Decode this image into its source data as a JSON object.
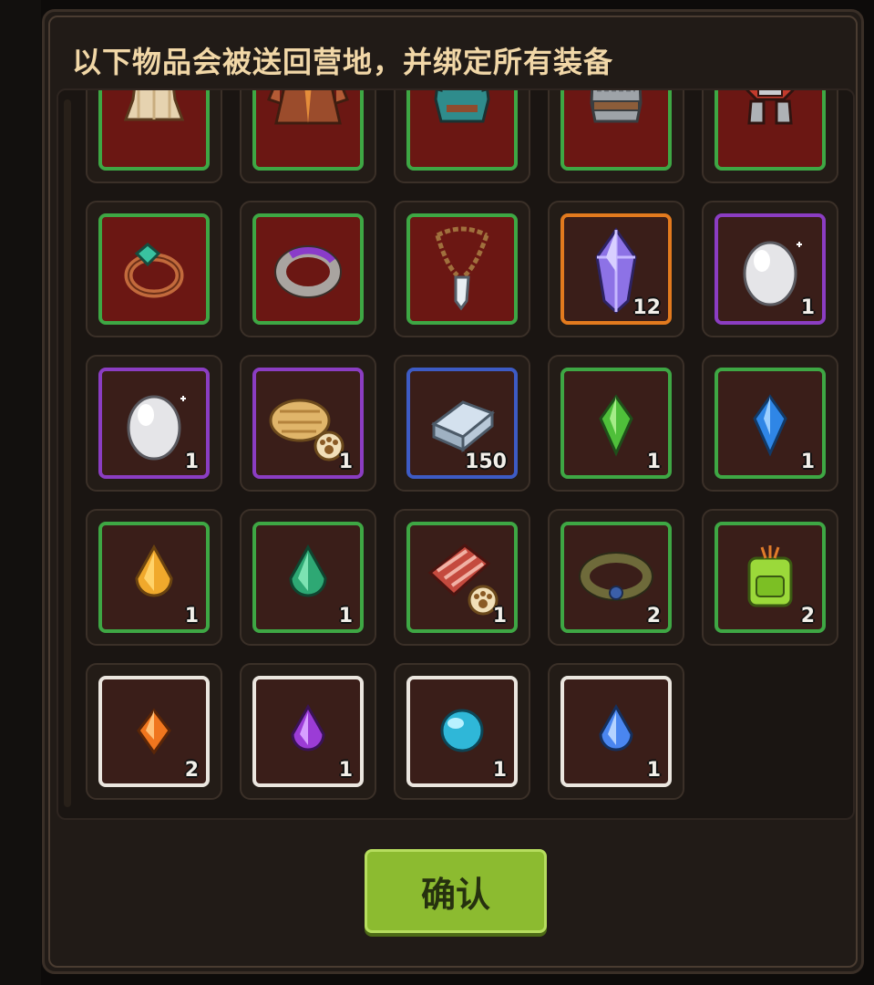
{
  "dialog": {
    "title": "以下物品会被送回营地，并绑定所有装备",
    "confirm_label": "确认"
  },
  "rows": [
    [
      {
        "name": "tan-robe-armor",
        "icon": "tan-robe-icon",
        "rarity": "green",
        "qty": ""
      },
      {
        "name": "brown-cloak-armor",
        "icon": "brown-cloak-icon",
        "rarity": "green",
        "qty": ""
      },
      {
        "name": "teal-tunic-armor",
        "icon": "teal-tunic-icon",
        "rarity": "green",
        "qty": ""
      },
      {
        "name": "chainmail-armor",
        "icon": "chainmail-icon",
        "rarity": "green",
        "qty": ""
      },
      {
        "name": "red-plate-armor",
        "icon": "red-plate-armor-icon",
        "rarity": "green",
        "qty": ""
      }
    ],
    [
      {
        "name": "emerald-ring",
        "icon": "emerald-ring-icon",
        "rarity": "green",
        "qty": ""
      },
      {
        "name": "purple-band-ring",
        "icon": "purple-band-ring-icon",
        "rarity": "green",
        "qty": ""
      },
      {
        "name": "crystal-necklace",
        "icon": "crystal-necklace-icon",
        "rarity": "green",
        "qty": ""
      },
      {
        "name": "purple-crystal",
        "icon": "purple-crystal-icon",
        "rarity": "orange",
        "qty": "12"
      },
      {
        "name": "white-egg",
        "icon": "white-egg-icon",
        "rarity": "purple",
        "qty": "1"
      }
    ],
    [
      {
        "name": "white-egg",
        "icon": "white-egg-icon",
        "rarity": "purple",
        "qty": "1"
      },
      {
        "name": "bread-pet-food",
        "icon": "bread-pet-food-icon",
        "rarity": "purple",
        "qty": "1"
      },
      {
        "name": "iron-ingot",
        "icon": "iron-ingot-icon",
        "rarity": "blue",
        "qty": "150"
      },
      {
        "name": "green-crystal",
        "icon": "green-crystal-icon",
        "rarity": "green",
        "qty": "1"
      },
      {
        "name": "blue-crystal",
        "icon": "blue-crystal-icon",
        "rarity": "green",
        "qty": "1"
      }
    ],
    [
      {
        "name": "amber-gem",
        "icon": "amber-gem-icon",
        "rarity": "green",
        "qty": "1"
      },
      {
        "name": "emerald-gem",
        "icon": "emerald-gem-icon",
        "rarity": "green",
        "qty": "1"
      },
      {
        "name": "meat-pet-food",
        "icon": "meat-pet-food-icon",
        "rarity": "green",
        "qty": "1"
      },
      {
        "name": "pet-collar",
        "icon": "pet-collar-icon",
        "rarity": "green",
        "qty": "2"
      },
      {
        "name": "green-backpack",
        "icon": "green-backpack-icon",
        "rarity": "green",
        "qty": "2"
      }
    ],
    [
      {
        "name": "orange-gem",
        "icon": "orange-gem-icon",
        "rarity": "white",
        "qty": "2"
      },
      {
        "name": "purple-gem",
        "icon": "purple-gem-icon",
        "rarity": "white",
        "qty": "1"
      },
      {
        "name": "cyan-orb",
        "icon": "cyan-orb-icon",
        "rarity": "white",
        "qty": "1"
      },
      {
        "name": "blue-drop-gem",
        "icon": "blue-drop-gem-icon",
        "rarity": "white",
        "qty": "1"
      }
    ]
  ],
  "colors": {
    "green": "#3ea744",
    "orange": "#e27a1e",
    "purple": "#8b3dc2",
    "blue": "#3d5bc4",
    "white": "#ebe6df",
    "confirm": "#8cbb30",
    "title": "#f1d7a7"
  }
}
